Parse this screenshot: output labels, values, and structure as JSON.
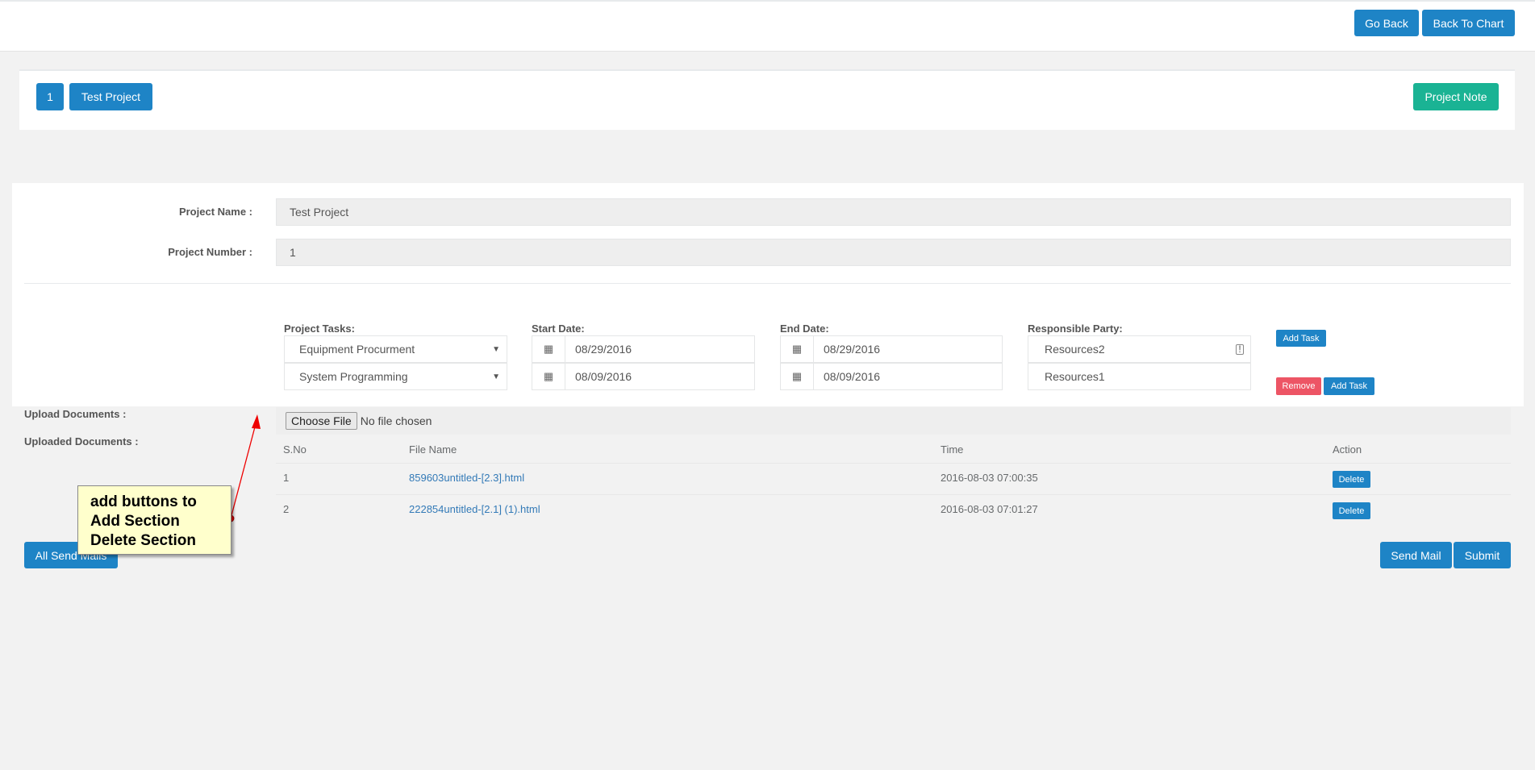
{
  "header": {
    "go_back": "Go Back",
    "back_to_chart": "Back To Chart"
  },
  "project_bar": {
    "number": "1",
    "name": "Test Project",
    "note_button": "Project Note"
  },
  "form": {
    "project_name_label": "Project Name :",
    "project_name": "Test Project",
    "project_number_label": "Project Number :",
    "project_number": "1",
    "tasks_label": "Project Tasks:",
    "start_label": "Start Date:",
    "end_label": "End Date:",
    "party_label": "Responsible Party:",
    "tasks": [
      {
        "task": "Equipment Procurment",
        "start": "08/29/2016",
        "end": "08/29/2016",
        "party": "Resources2"
      },
      {
        "task": "System Programming",
        "start": "08/09/2016",
        "end": "08/09/2016",
        "party": "Resources1"
      }
    ],
    "add_task": "Add Task",
    "remove": "Remove"
  },
  "upload": {
    "label": "Upload Documents :",
    "choose_file": "Choose File",
    "no_file": "No file chosen",
    "uploaded_label": "Uploaded Documents :"
  },
  "files": {
    "headers": [
      "S.No",
      "File Name",
      "Time",
      "Action"
    ],
    "rows": [
      {
        "sno": "1",
        "name": "859603untitled-[2.3].html",
        "time": "2016-08-03 07:00:35",
        "action": "Delete"
      },
      {
        "sno": "2",
        "name": "222854untitled-[2.1] (1).html",
        "time": "2016-08-03 07:01:27",
        "action": "Delete"
      }
    ]
  },
  "footer": {
    "all_send_mails": "All Send Mails",
    "send_mail": "Send Mail",
    "submit": "Submit"
  },
  "annotation": {
    "line1": "add buttons to",
    "line2": "Add Section",
    "line3": "Delete Section"
  }
}
